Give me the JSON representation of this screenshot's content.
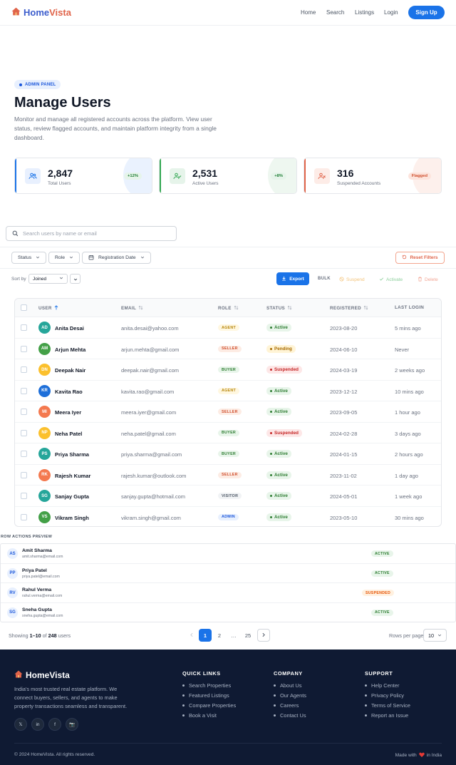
{
  "brand": {
    "name_part1": "Home",
    "name_part2": "Vista",
    "icon": "house-icon"
  },
  "nav": {
    "links": [
      "Home",
      "Search",
      "Listings",
      "Login"
    ],
    "cta": "Sign Up"
  },
  "hero": {
    "badge": "ADMIN PANEL",
    "title": "Manage Users",
    "description": "Monitor and manage all registered accounts across the platform. View user status, review flagged accounts, and maintain platform integrity from a single dashboard."
  },
  "stats": [
    {
      "value": "2,847",
      "label": "Total Users",
      "pill": "+12%",
      "accent": "#1a73e8",
      "icon": "users-icon"
    },
    {
      "value": "2,531",
      "label": "Active Users",
      "pill": "+8%",
      "accent": "#34a853",
      "icon": "user-check-icon"
    },
    {
      "value": "316",
      "label": "Suspended Accounts",
      "pill": "Flagged",
      "accent": "#e0644a",
      "icon": "user-x-icon"
    }
  ],
  "search": {
    "placeholder": "Search users by name or email"
  },
  "filters": {
    "status": "Status",
    "role": "Role",
    "date": "Registration Date",
    "reset": "Reset Filters"
  },
  "sort": {
    "label": "Sort by",
    "value": "Joined"
  },
  "actions": {
    "export": "Export",
    "bulk": "BULK",
    "suspend": "Suspend",
    "activate": "Activate",
    "delete": "Delete"
  },
  "table": {
    "headers": [
      "USER",
      "EMAIL",
      "ROLE",
      "STATUS",
      "REGISTERED",
      "LAST LOGIN"
    ],
    "rows": [
      {
        "initials": "AD",
        "name": "Anita Desai",
        "email": "anita.desai@yahoo.com",
        "role": "AGENT",
        "status": "Active",
        "registered": "2023-08-20",
        "last_login": "5 mins ago",
        "avatar": "#26a69a"
      },
      {
        "initials": "AM",
        "name": "Arjun Mehta",
        "email": "arjun.mehta@gmail.com",
        "role": "SELLER",
        "status": "Pending",
        "registered": "2024-06-10",
        "last_login": "Never",
        "avatar": "#43a047"
      },
      {
        "initials": "DN",
        "name": "Deepak Nair",
        "email": "deepak.nair@gmail.com",
        "role": "BUYER",
        "status": "Suspended",
        "registered": "2024-03-19",
        "last_login": "2 weeks ago",
        "avatar": "#fbc02d"
      },
      {
        "initials": "KR",
        "name": "Kavita Rao",
        "email": "kavita.rao@gmail.com",
        "role": "AGENT",
        "status": "Active",
        "registered": "2023-12-12",
        "last_login": "10 mins ago",
        "avatar": "#1e6fd9"
      },
      {
        "initials": "MI",
        "name": "Meera Iyer",
        "email": "meera.iyer@gmail.com",
        "role": "SELLER",
        "status": "Active",
        "registered": "2023-09-05",
        "last_login": "1 hour ago",
        "avatar": "#f4794f"
      },
      {
        "initials": "NP",
        "name": "Neha Patel",
        "email": "neha.patel@gmail.com",
        "role": "BUYER",
        "status": "Suspended",
        "registered": "2024-02-28",
        "last_login": "3 days ago",
        "avatar": "#fbc02d"
      },
      {
        "initials": "PS",
        "name": "Priya Sharma",
        "email": "priya.sharma@gmail.com",
        "role": "BUYER",
        "status": "Active",
        "registered": "2024-01-15",
        "last_login": "2 hours ago",
        "avatar": "#26a69a"
      },
      {
        "initials": "RK",
        "name": "Rajesh Kumar",
        "email": "rajesh.kumar@outlook.com",
        "role": "SELLER",
        "status": "Active",
        "registered": "2023-11-02",
        "last_login": "1 day ago",
        "avatar": "#f4794f"
      },
      {
        "initials": "SG",
        "name": "Sanjay Gupta",
        "email": "sanjay.gupta@hotmail.com",
        "role": "VISITOR",
        "status": "Active",
        "registered": "2024-05-01",
        "last_login": "1 week ago",
        "avatar": "#26a69a"
      },
      {
        "initials": "VS",
        "name": "Vikram Singh",
        "email": "vikram.singh@gmail.com",
        "role": "ADMIN",
        "status": "Active",
        "registered": "2023-05-10",
        "last_login": "30 mins ago",
        "avatar": "#43a047"
      }
    ]
  },
  "row_preview": {
    "title": "ROW ACTIONS PREVIEW",
    "rows": [
      {
        "initials": "AS",
        "name": "Amit Sharma",
        "email": "amit.sharma@email.com",
        "status": "ACTIVE"
      },
      {
        "initials": "PP",
        "name": "Priya Patel",
        "email": "priya.patel@email.com",
        "status": "ACTIVE"
      },
      {
        "initials": "RV",
        "name": "Rahul Verma",
        "email": "rahul.verma@email.com",
        "status": "SUSPENDED"
      },
      {
        "initials": "SG",
        "name": "Sneha Gupta",
        "email": "sneha.gupta@email.com",
        "status": "ACTIVE"
      }
    ]
  },
  "pagination": {
    "showing_prefix": "Showing",
    "range": "1–10",
    "of": "of",
    "total": "248",
    "suffix": "users",
    "pages": [
      "1",
      "2",
      "…",
      "25"
    ],
    "rows_per_page_label": "Rows per page",
    "rows_per_page": "10"
  },
  "footer": {
    "brand": "HomeVista",
    "tagline": "India's most trusted real estate platform. We connect buyers, sellers, and agents to make property transactions seamless and transparent.",
    "social": [
      "𝕏",
      "in",
      "f",
      "📷"
    ],
    "columns": [
      {
        "title": "QUICK LINKS",
        "links": [
          "Search Properties",
          "Featured Listings",
          "Compare Properties",
          "Book a Visit"
        ]
      },
      {
        "title": "COMPANY",
        "links": [
          "About Us",
          "Our Agents",
          "Careers",
          "Contact Us"
        ]
      },
      {
        "title": "SUPPORT",
        "links": [
          "Help Center",
          "Privacy Policy",
          "Terms of Service",
          "Report an Issue"
        ]
      }
    ],
    "copyright": "© 2024 HomeVista. All rights reserved.",
    "made_prefix": "Made with",
    "made_suffix": "in India"
  }
}
